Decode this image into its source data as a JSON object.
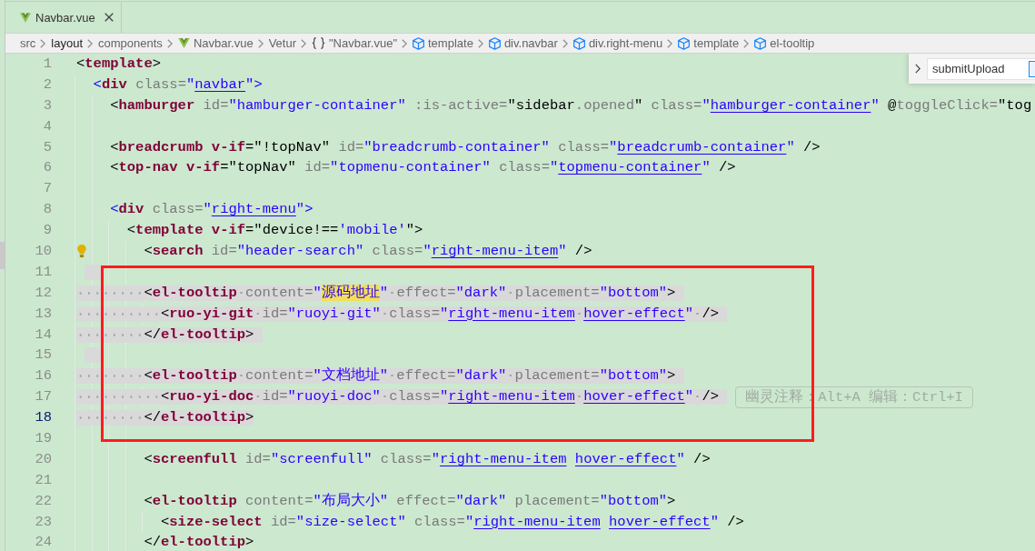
{
  "tabs": [
    {
      "label": "Navbar.vue",
      "selected": true
    }
  ],
  "breadcrumb": [
    {
      "kind": "folder",
      "label": "src",
      "selected": false
    },
    {
      "kind": "folder",
      "label": "layout",
      "selected": true
    },
    {
      "kind": "folder",
      "label": "components",
      "selected": false
    },
    {
      "kind": "vue-file",
      "label": "Navbar.vue",
      "selected": false
    },
    {
      "kind": "plain",
      "label": "Vetur",
      "selected": false
    },
    {
      "kind": "module",
      "label": "\"Navbar.vue\"",
      "selected": false
    },
    {
      "kind": "element",
      "label": "template",
      "selected": false
    },
    {
      "kind": "element",
      "label": "div.navbar",
      "selected": false
    },
    {
      "kind": "element",
      "label": "div.right-menu",
      "selected": false
    },
    {
      "kind": "element",
      "label": "template",
      "selected": false
    },
    {
      "kind": "element",
      "label": "el-tooltip",
      "selected": false
    }
  ],
  "find_widget": {
    "value": "submitUpload",
    "replace_expanded": false,
    "toggle": {
      "checked": true
    }
  },
  "annotations": [
    {
      "kind": "frame"
    }
  ],
  "editor": {
    "lines": [
      {
        "number": "1",
        "selected": false,
        "current": false,
        "code_action": false,
        "tokens": [
          {
            "kind": "punct",
            "text": "<"
          },
          {
            "kind": "tag",
            "text": "template"
          },
          {
            "kind": "punct",
            "text": ">"
          }
        ],
        "children": [
          {
            "number": "2",
            "selected": false,
            "current": false,
            "code_action": false,
            "tokens": [
              {
                "kind": "html-punct",
                "text": "<"
              },
              {
                "kind": "tag",
                "text": "div"
              },
              {
                "kind": "attr",
                "text": " class="
              },
              {
                "kind": "string",
                "text": "\""
              },
              {
                "kind": "link",
                "text": "navbar"
              },
              {
                "kind": "string",
                "text": "\""
              },
              {
                "kind": "html-punct",
                "text": ">"
              }
            ],
            "children": [
              {
                "number": "3",
                "selected": false,
                "current": false,
                "code_action": false,
                "tokens": [
                  {
                    "kind": "punct",
                    "text": "<"
                  },
                  {
                    "kind": "tag",
                    "text": "hamburger"
                  },
                  {
                    "kind": "attr",
                    "text": " id="
                  },
                  {
                    "kind": "string",
                    "text": "\"hamburger-container\""
                  },
                  {
                    "kind": "attr",
                    "text": " :is-active="
                  },
                  {
                    "kind": "expr",
                    "text": "\"sidebar"
                  },
                  {
                    "kind": "member",
                    "text": ".opened"
                  },
                  {
                    "kind": "expr",
                    "text": "\""
                  },
                  {
                    "kind": "attr",
                    "text": " class="
                  },
                  {
                    "kind": "string",
                    "text": "\""
                  },
                  {
                    "kind": "link",
                    "text": "hamburger-container"
                  },
                  {
                    "kind": "string",
                    "text": "\""
                  },
                  {
                    "kind": "expr",
                    "text": " @"
                  },
                  {
                    "kind": "attr",
                    "text": "toggleClick="
                  },
                  {
                    "kind": "expr",
                    "text": "\"tog"
                  }
                ]
              },
              {
                "number": "4",
                "selected": false,
                "current": false,
                "code_action": false
              },
              {
                "number": "5",
                "selected": false,
                "current": false,
                "code_action": false,
                "tokens": [
                  {
                    "kind": "punct",
                    "text": "<"
                  },
                  {
                    "kind": "tag",
                    "text": "breadcrumb"
                  },
                  {
                    "kind": "directive",
                    "text": " v-if"
                  },
                  {
                    "kind": "expr",
                    "text": "=\"!topNav\""
                  },
                  {
                    "kind": "attr",
                    "text": " id="
                  },
                  {
                    "kind": "string",
                    "text": "\"breadcrumb-container\""
                  },
                  {
                    "kind": "attr",
                    "text": " class="
                  },
                  {
                    "kind": "string",
                    "text": "\""
                  },
                  {
                    "kind": "link",
                    "text": "breadcrumb-container"
                  },
                  {
                    "kind": "string",
                    "text": "\""
                  },
                  {
                    "kind": "punct",
                    "text": " />"
                  }
                ]
              },
              {
                "number": "6",
                "selected": false,
                "current": false,
                "code_action": false,
                "tokens": [
                  {
                    "kind": "punct",
                    "text": "<"
                  },
                  {
                    "kind": "tag",
                    "text": "top-nav"
                  },
                  {
                    "kind": "directive",
                    "text": " v-if"
                  },
                  {
                    "kind": "expr",
                    "text": "=\"topNav\""
                  },
                  {
                    "kind": "attr",
                    "text": " id="
                  },
                  {
                    "kind": "string",
                    "text": "\"topmenu-container\""
                  },
                  {
                    "kind": "attr",
                    "text": " class="
                  },
                  {
                    "kind": "string",
                    "text": "\""
                  },
                  {
                    "kind": "link",
                    "text": "topmenu-container"
                  },
                  {
                    "kind": "string",
                    "text": "\""
                  },
                  {
                    "kind": "punct",
                    "text": " />"
                  }
                ]
              },
              {
                "number": "7",
                "selected": false,
                "current": false,
                "code_action": false
              },
              {
                "number": "8",
                "selected": false,
                "current": false,
                "code_action": false,
                "tokens": [
                  {
                    "kind": "html-punct",
                    "text": "<"
                  },
                  {
                    "kind": "tag",
                    "text": "div"
                  },
                  {
                    "kind": "attr",
                    "text": " class="
                  },
                  {
                    "kind": "string",
                    "text": "\""
                  },
                  {
                    "kind": "link",
                    "text": "right-menu"
                  },
                  {
                    "kind": "string",
                    "text": "\""
                  },
                  {
                    "kind": "html-punct",
                    "text": ">"
                  }
                ],
                "children": [
                  {
                    "number": "9",
                    "selected": false,
                    "current": false,
                    "code_action": false,
                    "tokens": [
                      {
                        "kind": "punct",
                        "text": "<"
                      },
                      {
                        "kind": "tag",
                        "text": "template"
                      },
                      {
                        "kind": "directive",
                        "text": " v-if"
                      },
                      {
                        "kind": "expr",
                        "text": "=\"device!=="
                      },
                      {
                        "kind": "string",
                        "text": "'mobile'"
                      },
                      {
                        "kind": "punct",
                        "text": "\">"
                      }
                    ],
                    "children": [
                      {
                        "number": "10",
                        "selected": false,
                        "current": false,
                        "code_action": true,
                        "tokens": [
                          {
                            "kind": "punct",
                            "text": "<"
                          },
                          {
                            "kind": "tag",
                            "text": "search"
                          },
                          {
                            "kind": "attr",
                            "text": " id="
                          },
                          {
                            "kind": "string",
                            "text": "\"header-search\""
                          },
                          {
                            "kind": "attr",
                            "text": " class="
                          },
                          {
                            "kind": "string",
                            "text": "\""
                          },
                          {
                            "kind": "link",
                            "text": "right-menu-item"
                          },
                          {
                            "kind": "string",
                            "text": "\""
                          },
                          {
                            "kind": "punct",
                            "text": " />"
                          }
                        ]
                      },
                      {
                        "number": "11",
                        "selected": true,
                        "current": false,
                        "code_action": false
                      },
                      {
                        "number": "12",
                        "selected": true,
                        "current": false,
                        "code_action": false,
                        "tokens": [
                          {
                            "kind": "punct",
                            "text": "<"
                          },
                          {
                            "kind": "tag",
                            "text": "el-tooltip"
                          },
                          {
                            "kind": "attr",
                            "text": " content="
                          },
                          {
                            "kind": "string",
                            "text": "\""
                          },
                          {
                            "kind": "match",
                            "text": "源码地址"
                          },
                          {
                            "kind": "string",
                            "text": "\""
                          },
                          {
                            "kind": "attr",
                            "text": " effect="
                          },
                          {
                            "kind": "string",
                            "text": "\"dark\""
                          },
                          {
                            "kind": "attr",
                            "text": " placement="
                          },
                          {
                            "kind": "string",
                            "text": "\"bottom\""
                          },
                          {
                            "kind": "punct",
                            "text": ">"
                          }
                        ],
                        "children": [
                          {
                            "number": "13",
                            "selected": true,
                            "current": false,
                            "code_action": false,
                            "tokens": [
                              {
                                "kind": "punct",
                                "text": "<"
                              },
                              {
                                "kind": "tag",
                                "text": "ruo-yi-git"
                              },
                              {
                                "kind": "attr",
                                "text": " id="
                              },
                              {
                                "kind": "string",
                                "text": "\"ruoyi-git\""
                              },
                              {
                                "kind": "attr",
                                "text": " class="
                              },
                              {
                                "kind": "string",
                                "text": "\""
                              },
                              {
                                "kind": "link",
                                "text": "right-menu-item hover-effect"
                              },
                              {
                                "kind": "string",
                                "text": "\""
                              },
                              {
                                "kind": "punct",
                                "text": " />"
                              }
                            ]
                          }
                        ]
                      },
                      {
                        "number": "14",
                        "selected": true,
                        "current": false,
                        "code_action": false,
                        "tokens": [
                          {
                            "kind": "punct",
                            "text": "</"
                          },
                          {
                            "kind": "tag",
                            "text": "el-tooltip"
                          },
                          {
                            "kind": "punct",
                            "text": ">"
                          }
                        ]
                      },
                      {
                        "number": "15",
                        "selected": true,
                        "current": false,
                        "code_action": false
                      },
                      {
                        "number": "16",
                        "selected": true,
                        "current": false,
                        "code_action": false,
                        "tokens": [
                          {
                            "kind": "punct",
                            "text": "<"
                          },
                          {
                            "kind": "tag",
                            "text": "el-tooltip"
                          },
                          {
                            "kind": "attr",
                            "text": " content="
                          },
                          {
                            "kind": "string",
                            "text": "\"文档地址\""
                          },
                          {
                            "kind": "attr",
                            "text": " effect="
                          },
                          {
                            "kind": "string",
                            "text": "\"dark\""
                          },
                          {
                            "kind": "attr",
                            "text": " placement="
                          },
                          {
                            "kind": "string",
                            "text": "\"bottom\""
                          },
                          {
                            "kind": "punct",
                            "text": ">"
                          }
                        ],
                        "children": [
                          {
                            "number": "17",
                            "selected": true,
                            "current": false,
                            "code_action": false,
                            "tokens": [
                              {
                                "kind": "punct",
                                "text": "<"
                              },
                              {
                                "kind": "tag",
                                "text": "ruo-yi-doc"
                              },
                              {
                                "kind": "attr",
                                "text": " id="
                              },
                              {
                                "kind": "string",
                                "text": "\"ruoyi-doc\""
                              },
                              {
                                "kind": "attr",
                                "text": " class="
                              },
                              {
                                "kind": "string",
                                "text": "\""
                              },
                              {
                                "kind": "link",
                                "text": "right-menu-item hover-effect"
                              },
                              {
                                "kind": "string",
                                "text": "\""
                              },
                              {
                                "kind": "punct",
                                "text": " />"
                              }
                            ],
                            "inlay_hint": "幽灵注释：Alt+A 编辑：Ctrl+I"
                          }
                        ]
                      },
                      {
                        "number": "18",
                        "selected": true,
                        "current": true,
                        "code_action": false,
                        "tokens": [
                          {
                            "kind": "punct",
                            "text": "</"
                          },
                          {
                            "kind": "tag",
                            "text": "el-tooltip"
                          },
                          {
                            "kind": "punct",
                            "text": ">"
                          }
                        ]
                      },
                      {
                        "number": "19",
                        "selected": false,
                        "current": false,
                        "code_action": false
                      },
                      {
                        "number": "20",
                        "selected": false,
                        "current": false,
                        "code_action": false,
                        "tokens": [
                          {
                            "kind": "punct",
                            "text": "<"
                          },
                          {
                            "kind": "tag",
                            "text": "screenfull"
                          },
                          {
                            "kind": "attr",
                            "text": " id="
                          },
                          {
                            "kind": "string",
                            "text": "\"screenfull\""
                          },
                          {
                            "kind": "attr",
                            "text": " class="
                          },
                          {
                            "kind": "string",
                            "text": "\""
                          },
                          {
                            "kind": "link",
                            "text": "right-menu-item hover-effect"
                          },
                          {
                            "kind": "string",
                            "text": "\""
                          },
                          {
                            "kind": "punct",
                            "text": " />"
                          }
                        ]
                      },
                      {
                        "number": "21",
                        "selected": false,
                        "current": false,
                        "code_action": false
                      },
                      {
                        "number": "22",
                        "selected": false,
                        "current": false,
                        "code_action": false,
                        "tokens": [
                          {
                            "kind": "punct",
                            "text": "<"
                          },
                          {
                            "kind": "tag",
                            "text": "el-tooltip"
                          },
                          {
                            "kind": "attr",
                            "text": " content="
                          },
                          {
                            "kind": "string",
                            "text": "\"布局大小\""
                          },
                          {
                            "kind": "attr",
                            "text": " effect="
                          },
                          {
                            "kind": "string",
                            "text": "\"dark\""
                          },
                          {
                            "kind": "attr",
                            "text": " placement="
                          },
                          {
                            "kind": "string",
                            "text": "\"bottom\""
                          },
                          {
                            "kind": "punct",
                            "text": ">"
                          }
                        ],
                        "children": [
                          {
                            "number": "23",
                            "selected": false,
                            "current": false,
                            "code_action": false,
                            "tokens": [
                              {
                                "kind": "punct",
                                "text": "<"
                              },
                              {
                                "kind": "tag",
                                "text": "size-select"
                              },
                              {
                                "kind": "attr",
                                "text": " id="
                              },
                              {
                                "kind": "string",
                                "text": "\"size-select\""
                              },
                              {
                                "kind": "attr",
                                "text": " class="
                              },
                              {
                                "kind": "string",
                                "text": "\""
                              },
                              {
                                "kind": "link",
                                "text": "right-menu-item hover-effect"
                              },
                              {
                                "kind": "string",
                                "text": "\""
                              },
                              {
                                "kind": "punct",
                                "text": " />"
                              }
                            ]
                          }
                        ]
                      },
                      {
                        "number": "24",
                        "selected": false,
                        "current": false,
                        "code_action": false,
                        "tokens": [
                          {
                            "kind": "punct",
                            "text": "</"
                          },
                          {
                            "kind": "tag",
                            "text": "el-tooltip"
                          },
                          {
                            "kind": "punct",
                            "text": ">"
                          }
                        ]
                      }
                    ]
                  }
                ]
              }
            ]
          }
        ]
      }
    ]
  }
}
